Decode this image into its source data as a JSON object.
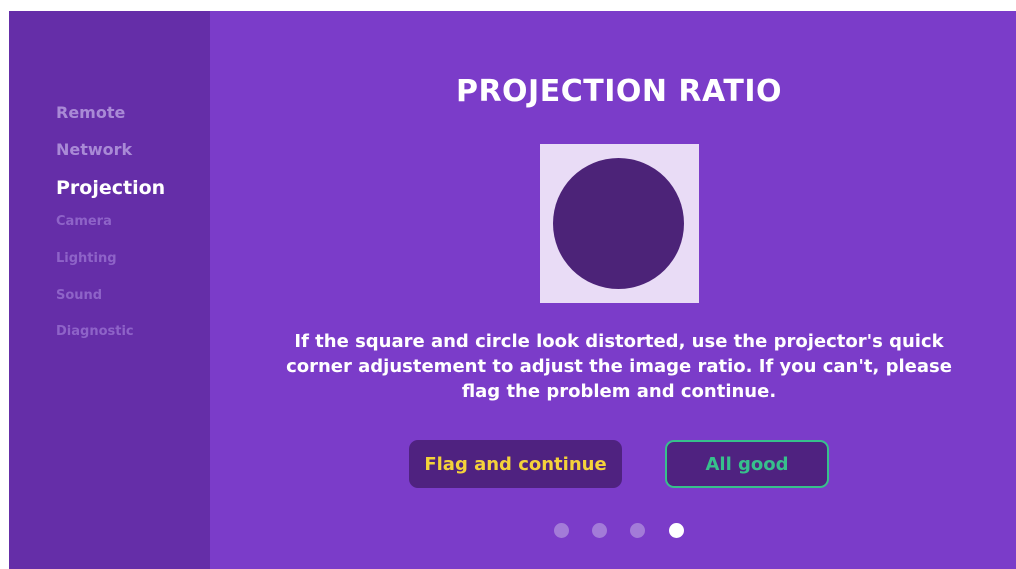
{
  "sidebar": {
    "items": [
      {
        "label": "Remote"
      },
      {
        "label": "Network"
      },
      {
        "label": "Projection"
      },
      {
        "label": "Camera"
      },
      {
        "label": "Lighting"
      },
      {
        "label": "Sound"
      },
      {
        "label": "Diagnostic"
      }
    ],
    "active_item": "Projection"
  },
  "main": {
    "title": "PROJECTION RATIO",
    "description": "If the square and circle look distorted, use the projector's quick corner adjustement to adjust the image ratio. If you can't, please flag the problem and continue.",
    "buttons": {
      "flag_label": "Flag and continue",
      "good_label": "All good"
    },
    "pagination": {
      "total": 4,
      "current": 4
    }
  },
  "colors": {
    "background": "#7b3cc9",
    "sidebar": "#652ea8",
    "button_bg": "#4f2280",
    "flag_text": "#f4d23a",
    "good_accent": "#37c08c",
    "pattern_square": "#e9dcf6",
    "pattern_circle": "#4c2378"
  }
}
